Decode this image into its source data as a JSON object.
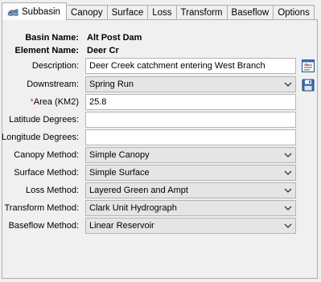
{
  "tabs": [
    {
      "label": "Subbasin",
      "active": true
    },
    {
      "label": "Canopy"
    },
    {
      "label": "Surface"
    },
    {
      "label": "Loss"
    },
    {
      "label": "Transform"
    },
    {
      "label": "Baseflow"
    },
    {
      "label": "Options"
    }
  ],
  "basin": {
    "label": "Basin Name:",
    "value": "Alt Post Dam"
  },
  "element": {
    "label": "Element Name:",
    "value": "Deer Cr"
  },
  "description": {
    "label": "Description:",
    "value": "Deer Creek catchment entering West Branch"
  },
  "downstream": {
    "label": "Downstream:",
    "value": "Spring Run"
  },
  "area": {
    "required_mark": "*",
    "label": "Area (KM2)",
    "value": "25.8"
  },
  "latitude": {
    "label": "Latitude Degrees:",
    "value": ""
  },
  "longitude": {
    "label": "Longitude Degrees:",
    "value": ""
  },
  "canopy": {
    "label": "Canopy Method:",
    "value": "Simple Canopy"
  },
  "surface": {
    "label": "Surface Method:",
    "value": "Simple Surface"
  },
  "loss": {
    "label": "Loss Method:",
    "value": "Layered Green and Ampt"
  },
  "transform": {
    "label": "Transform Method:",
    "value": "Clark Unit Hydrograph"
  },
  "baseflow": {
    "label": "Baseflow Method:",
    "value": "Linear Reservoir"
  },
  "icons": {
    "subbasin_tab": "subbasin-icon",
    "description_button": "description-editor-icon",
    "downstream_button": "save-downstream-icon",
    "dropdown": "chevron-down-icon"
  },
  "colors": {
    "required": "#e03030",
    "select_bg": "#e5e5e5",
    "panel_bg": "#f0f0f0"
  }
}
